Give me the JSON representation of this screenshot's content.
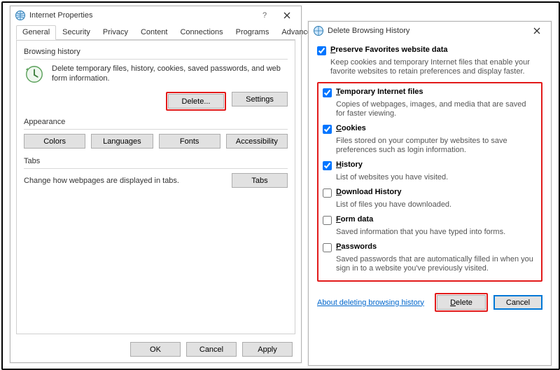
{
  "ip": {
    "title": "Internet Properties",
    "tabs": [
      "General",
      "Security",
      "Privacy",
      "Content",
      "Connections",
      "Programs",
      "Advanced"
    ],
    "browsingHistory": {
      "label": "Browsing history",
      "desc": "Delete temporary files, history, cookies, saved passwords, and web form information.",
      "delete": "Delete...",
      "settings": "Settings"
    },
    "appearance": {
      "label": "Appearance",
      "colors": "Colors",
      "languages": "Languages",
      "fonts": "Fonts",
      "accessibility": "Accessibility"
    },
    "tabsSection": {
      "label": "Tabs",
      "desc": "Change how webpages are displayed in tabs.",
      "btn": "Tabs"
    },
    "footer": {
      "ok": "OK",
      "cancel": "Cancel",
      "apply": "Apply"
    }
  },
  "dbh": {
    "title": "Delete Browsing History",
    "preserve": {
      "label": "Preserve Favorites website data",
      "desc": "Keep cookies and temporary Internet files that enable your favorite websites to retain preferences and display faster."
    },
    "temp": {
      "label": "Temporary Internet files",
      "desc": "Copies of webpages, images, and media that are saved for faster viewing."
    },
    "cookies": {
      "label": "Cookies",
      "desc": "Files stored on your computer by websites to save preferences such as login information."
    },
    "history": {
      "label": "History",
      "desc": "List of websites you have visited."
    },
    "download": {
      "label": "Download History",
      "desc": "List of files you have downloaded."
    },
    "form": {
      "label": "Form data",
      "desc": "Saved information that you have typed into forms."
    },
    "passwords": {
      "label": "Passwords",
      "desc": "Saved passwords that are automatically filled in when you sign in to a website you've previously visited."
    },
    "link": "About deleting browsing history",
    "delete": "Delete",
    "cancel": "Cancel"
  }
}
